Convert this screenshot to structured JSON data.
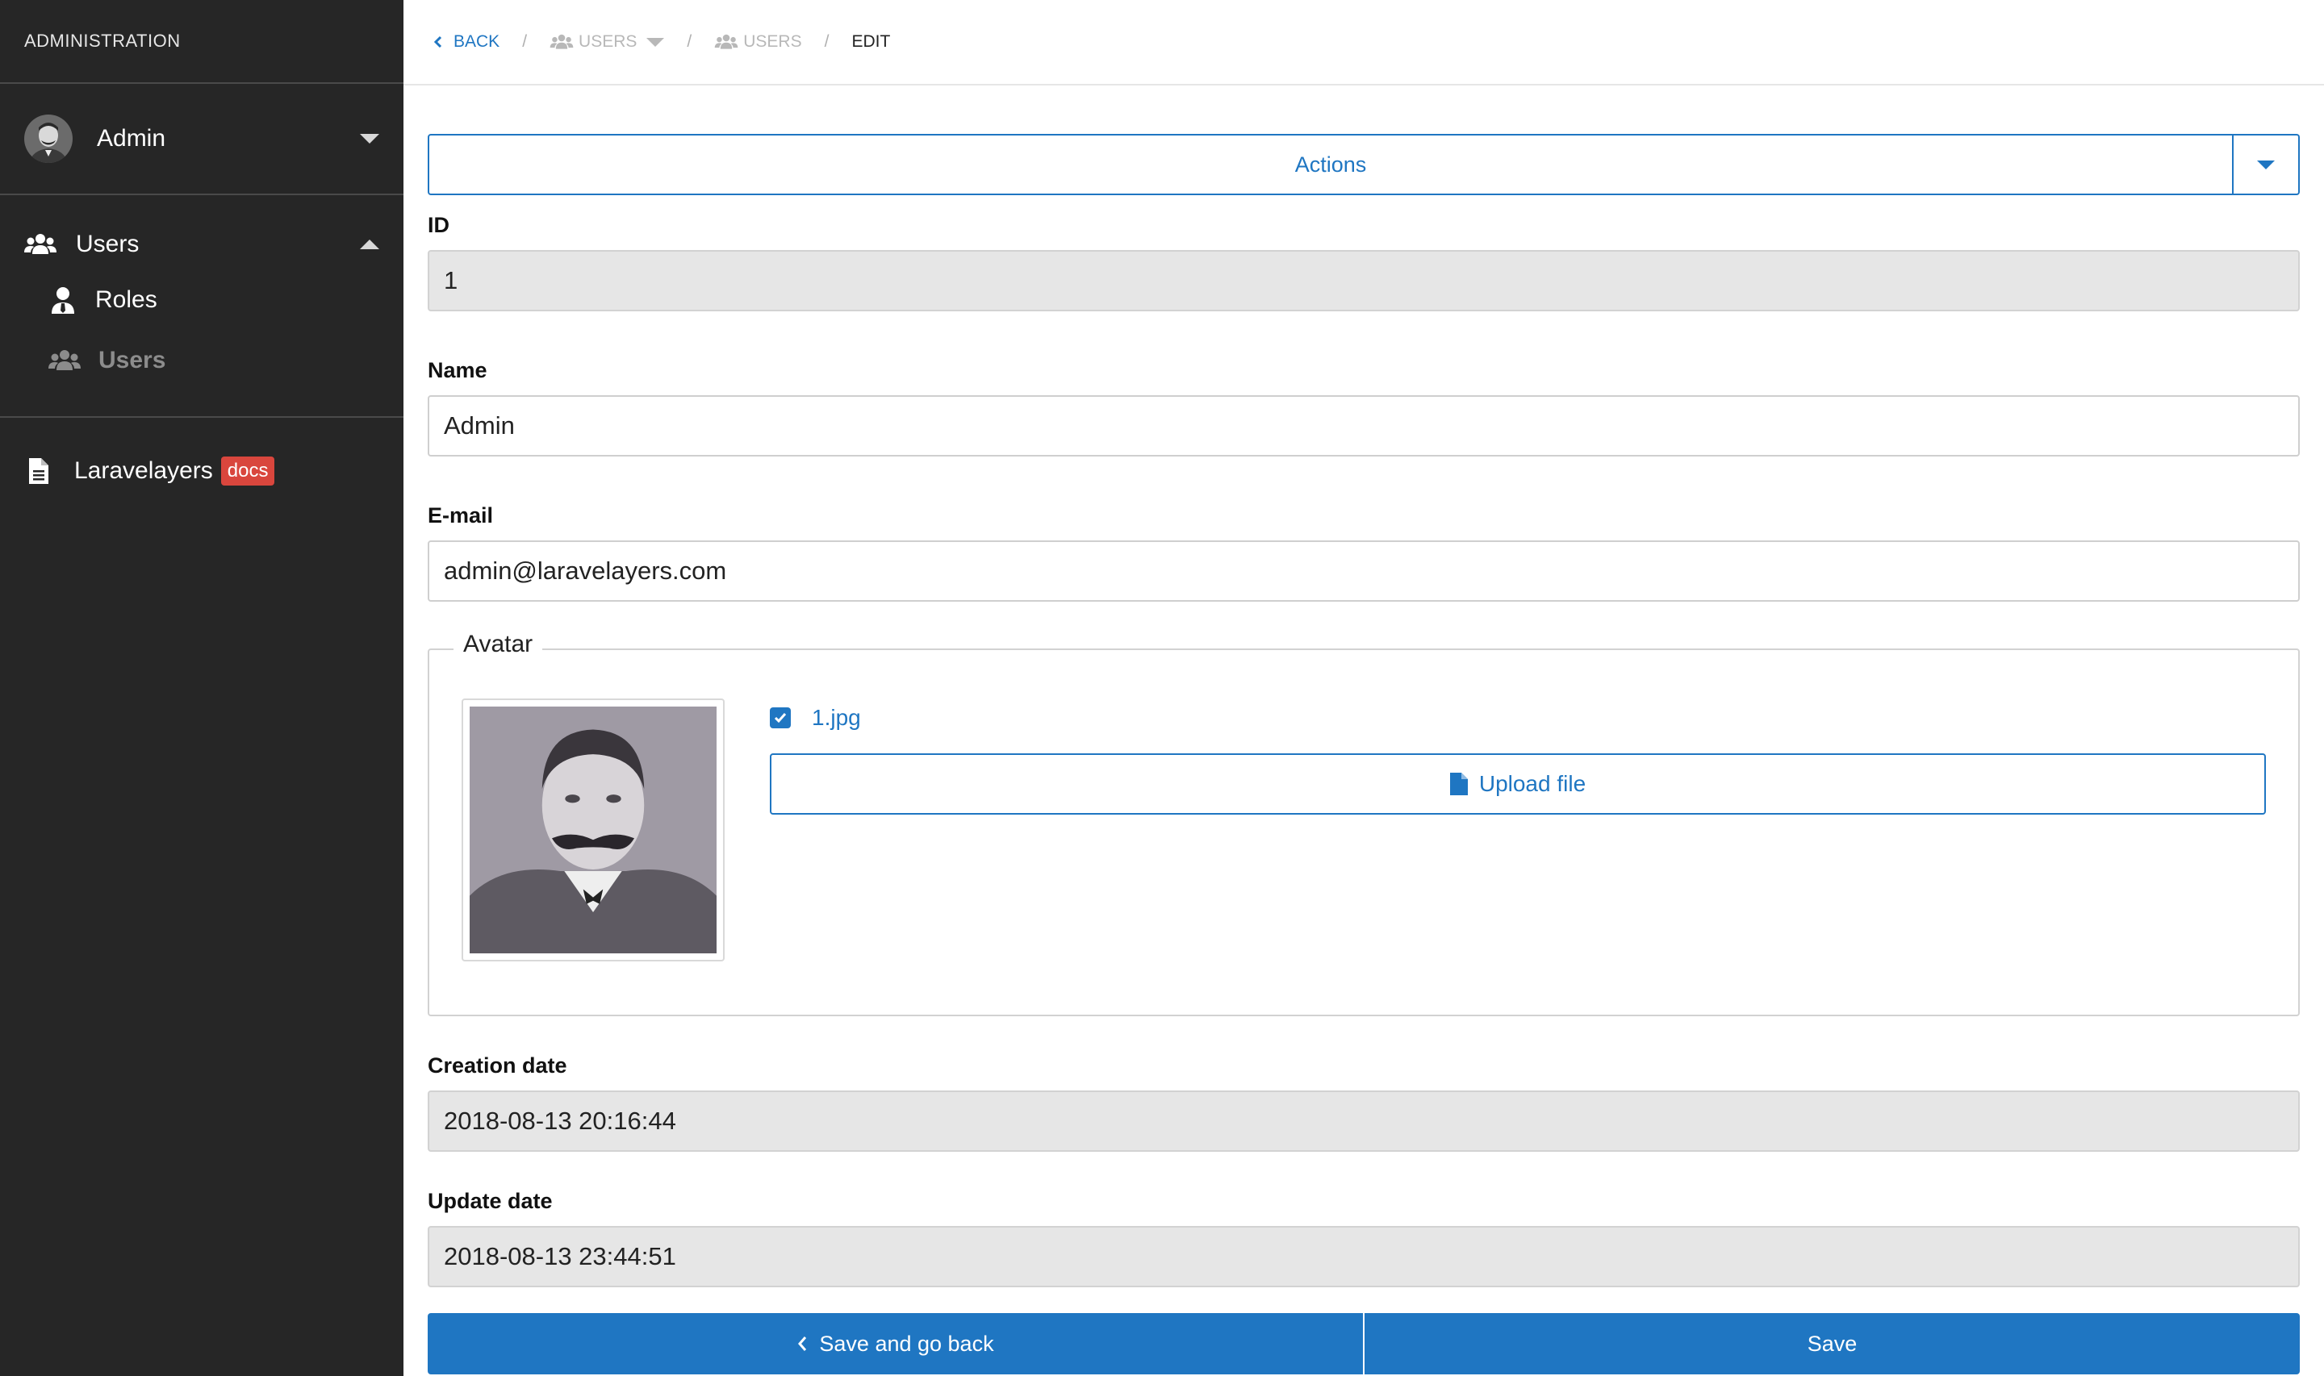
{
  "sidebar": {
    "title": "ADMINISTRATION",
    "user_name": "Admin",
    "nav": {
      "users_label": "Users",
      "roles_label": "Roles",
      "users_sub_label": "Users"
    },
    "external": {
      "label": "Laravelayers",
      "badge": "docs"
    }
  },
  "breadcrumb": {
    "back": "BACK",
    "users_dropdown": "USERS",
    "users": "USERS",
    "current": "EDIT"
  },
  "form": {
    "actions_label": "Actions",
    "id": {
      "label": "ID",
      "value": "1"
    },
    "name": {
      "label": "Name",
      "value": "Admin"
    },
    "email": {
      "label": "E-mail",
      "value": "admin@laravelayers.com"
    },
    "avatar": {
      "legend": "Avatar",
      "file_name": "1.jpg",
      "file_checked": true,
      "upload_label": "Upload file"
    },
    "created_at": {
      "label": "Creation date",
      "value": "2018-08-13 20:16:44"
    },
    "updated_at": {
      "label": "Update date",
      "value": "2018-08-13 23:44:51"
    },
    "save_back_label": "Save and go back",
    "save_label": "Save"
  },
  "colors": {
    "accent": "#1f76c2",
    "sidebar_bg": "#262626",
    "badge": "#d9463d",
    "readonly_bg": "#e6e6e6"
  }
}
